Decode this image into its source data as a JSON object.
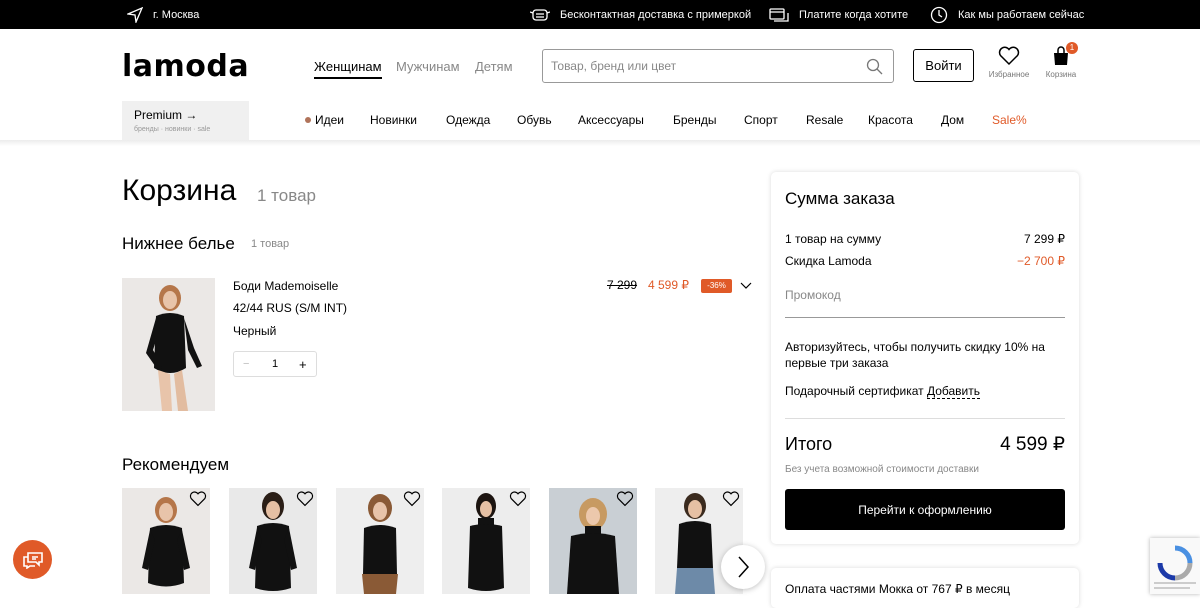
{
  "topbar": {
    "city": "г. Москва",
    "delivery": "Бесконтактная доставка с примеркой",
    "pay": "Платите когда хотите",
    "how": "Как мы работаем сейчас"
  },
  "header": {
    "logo": "lamoda",
    "genders": [
      "Женщинам",
      "Мужчинам",
      "Детям"
    ],
    "search_placeholder": "Товар, бренд или цвет",
    "login": "Войти",
    "favorites": "Избранное",
    "cart": "Корзина",
    "cart_count": "1"
  },
  "premium": {
    "title": "Premium →",
    "sub": "бренды · новинки · sale"
  },
  "nav": [
    "Идеи",
    "Новинки",
    "Одежда",
    "Обувь",
    "Аксессуары",
    "Бренды",
    "Спорт",
    "Resale",
    "Красота",
    "Дом",
    "Sale%"
  ],
  "page": {
    "title": "Корзина",
    "count": "1 товар",
    "section": "Нижнее белье",
    "section_count": "1 товар",
    "recommend": "Рекомендуем"
  },
  "product": {
    "name": "Боди Mademoiselle",
    "size": "42/44 RUS (S/M INT)",
    "color": "Черный",
    "qty": "1",
    "old_price": "7 299",
    "new_price": "4 599 ₽",
    "discount": "-36%"
  },
  "summary": {
    "title": "Сумма заказа",
    "items_label": "1 товар на сумму",
    "items_value": "7 299 ₽",
    "discount_label": "Скидка Lamoda",
    "discount_value": "−2 700 ₽",
    "promo": "Промокод",
    "auth": "Авторизуйтесь, чтобы получить скидку 10% на первые три заказа",
    "gift_label": "Подарочный сертификат",
    "gift_link": "Добавить",
    "total_label": "Итого",
    "total_value": "4 599 ₽",
    "note": "Без учета возможной стоимости доставки",
    "checkout": "Перейти к оформлению"
  },
  "mokka": "Оплата частями Мокка от 767 ₽ в месяц",
  "colors": {
    "accent": "#e05a28",
    "black": "#000000"
  }
}
